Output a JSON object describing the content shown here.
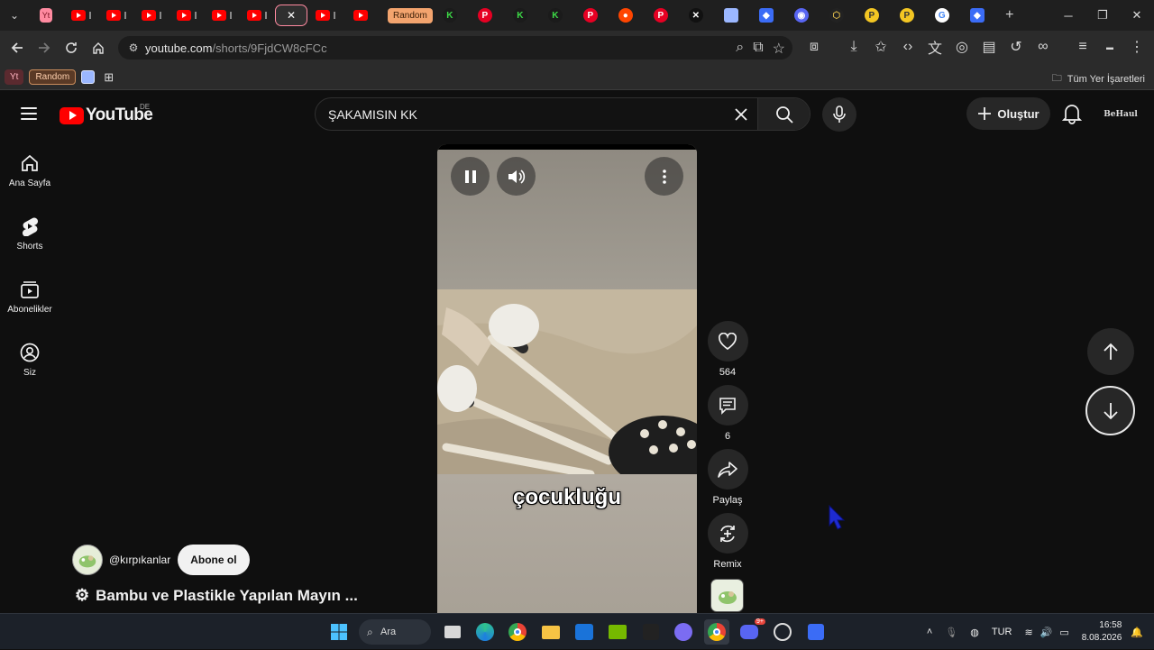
{
  "browser": {
    "tabs_bookmark_labels": {
      "yt_pill": "Yt",
      "random_pill": "Random"
    },
    "tab_random_label": "Random",
    "url_host": "youtube.com",
    "url_path": "/shorts/9FjdCW8cFCc",
    "bookmarks_all_label": "Tüm Yer İşaretleri"
  },
  "yt": {
    "logo_text": "YouTube",
    "country": "DE",
    "search_value": "ŞAKAMISIN KK",
    "create_label": "Oluştur",
    "account_text": "BeHaul",
    "nav": [
      {
        "label": "Ana Sayfa"
      },
      {
        "label": "Shorts"
      },
      {
        "label": "Abonelikler"
      },
      {
        "label": "Siz"
      }
    ],
    "short": {
      "caption": "çocukluğu",
      "likes": "564",
      "comments": "6",
      "share_label": "Paylaş",
      "remix_label": "Remix",
      "channel": "@kırpıkanlar",
      "subscribe_label": "Abone ol",
      "title": "Bambu ve Plastikle Yapılan Mayın ..."
    }
  },
  "taskbar": {
    "search_label": "Ara",
    "lang": "TUR",
    "time": "16:58",
    "date": "8.08.2026",
    "discord_badge": "9+"
  },
  "colors": {
    "accent": "#ff0000",
    "bg": "#0f0f0f"
  }
}
